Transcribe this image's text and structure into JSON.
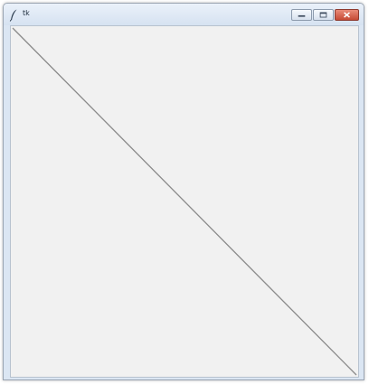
{
  "window": {
    "title": "tk",
    "app_icon": "feather-icon",
    "controls": {
      "minimize_icon": "minimize-icon",
      "maximize_icon": "maximize-icon",
      "close_icon": "close-icon"
    }
  },
  "canvas": {
    "background_color": "#f1f1f1",
    "line_color": "#8a8a8a"
  }
}
